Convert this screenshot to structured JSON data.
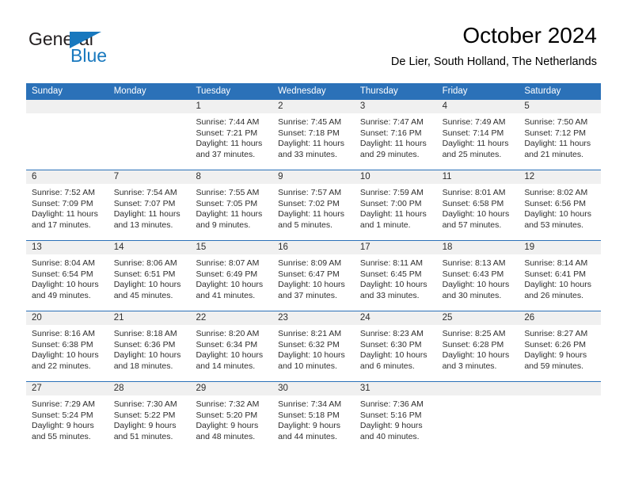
{
  "brand": {
    "name_part1": "General",
    "name_part2": "Blue",
    "mark_icon": "blue-triangle-flag-icon",
    "accent_color": "#1878be"
  },
  "header": {
    "title": "October 2024",
    "subtitle": "De Lier, South Holland, The Netherlands"
  },
  "theme": {
    "header_blue": "#2b71b8",
    "band_gray": "#f0f0f0",
    "text": "#2e2e2e"
  },
  "calendar": {
    "weekday_headers": [
      "Sunday",
      "Monday",
      "Tuesday",
      "Wednesday",
      "Thursday",
      "Friday",
      "Saturday"
    ],
    "weeks": [
      [
        {
          "day": "",
          "lines": [
            "",
            "",
            "",
            ""
          ],
          "empty": true
        },
        {
          "day": "",
          "lines": [
            "",
            "",
            "",
            ""
          ],
          "empty": true
        },
        {
          "day": "1",
          "lines": [
            "Sunrise: 7:44 AM",
            "Sunset: 7:21 PM",
            "Daylight: 11 hours",
            "and 37 minutes."
          ]
        },
        {
          "day": "2",
          "lines": [
            "Sunrise: 7:45 AM",
            "Sunset: 7:18 PM",
            "Daylight: 11 hours",
            "and 33 minutes."
          ]
        },
        {
          "day": "3",
          "lines": [
            "Sunrise: 7:47 AM",
            "Sunset: 7:16 PM",
            "Daylight: 11 hours",
            "and 29 minutes."
          ]
        },
        {
          "day": "4",
          "lines": [
            "Sunrise: 7:49 AM",
            "Sunset: 7:14 PM",
            "Daylight: 11 hours",
            "and 25 minutes."
          ]
        },
        {
          "day": "5",
          "lines": [
            "Sunrise: 7:50 AM",
            "Sunset: 7:12 PM",
            "Daylight: 11 hours",
            "and 21 minutes."
          ]
        }
      ],
      [
        {
          "day": "6",
          "lines": [
            "Sunrise: 7:52 AM",
            "Sunset: 7:09 PM",
            "Daylight: 11 hours",
            "and 17 minutes."
          ]
        },
        {
          "day": "7",
          "lines": [
            "Sunrise: 7:54 AM",
            "Sunset: 7:07 PM",
            "Daylight: 11 hours",
            "and 13 minutes."
          ]
        },
        {
          "day": "8",
          "lines": [
            "Sunrise: 7:55 AM",
            "Sunset: 7:05 PM",
            "Daylight: 11 hours",
            "and 9 minutes."
          ]
        },
        {
          "day": "9",
          "lines": [
            "Sunrise: 7:57 AM",
            "Sunset: 7:02 PM",
            "Daylight: 11 hours",
            "and 5 minutes."
          ]
        },
        {
          "day": "10",
          "lines": [
            "Sunrise: 7:59 AM",
            "Sunset: 7:00 PM",
            "Daylight: 11 hours",
            "and 1 minute."
          ]
        },
        {
          "day": "11",
          "lines": [
            "Sunrise: 8:01 AM",
            "Sunset: 6:58 PM",
            "Daylight: 10 hours",
            "and 57 minutes."
          ]
        },
        {
          "day": "12",
          "lines": [
            "Sunrise: 8:02 AM",
            "Sunset: 6:56 PM",
            "Daylight: 10 hours",
            "and 53 minutes."
          ]
        }
      ],
      [
        {
          "day": "13",
          "lines": [
            "Sunrise: 8:04 AM",
            "Sunset: 6:54 PM",
            "Daylight: 10 hours",
            "and 49 minutes."
          ]
        },
        {
          "day": "14",
          "lines": [
            "Sunrise: 8:06 AM",
            "Sunset: 6:51 PM",
            "Daylight: 10 hours",
            "and 45 minutes."
          ]
        },
        {
          "day": "15",
          "lines": [
            "Sunrise: 8:07 AM",
            "Sunset: 6:49 PM",
            "Daylight: 10 hours",
            "and 41 minutes."
          ]
        },
        {
          "day": "16",
          "lines": [
            "Sunrise: 8:09 AM",
            "Sunset: 6:47 PM",
            "Daylight: 10 hours",
            "and 37 minutes."
          ]
        },
        {
          "day": "17",
          "lines": [
            "Sunrise: 8:11 AM",
            "Sunset: 6:45 PM",
            "Daylight: 10 hours",
            "and 33 minutes."
          ]
        },
        {
          "day": "18",
          "lines": [
            "Sunrise: 8:13 AM",
            "Sunset: 6:43 PM",
            "Daylight: 10 hours",
            "and 30 minutes."
          ]
        },
        {
          "day": "19",
          "lines": [
            "Sunrise: 8:14 AM",
            "Sunset: 6:41 PM",
            "Daylight: 10 hours",
            "and 26 minutes."
          ]
        }
      ],
      [
        {
          "day": "20",
          "lines": [
            "Sunrise: 8:16 AM",
            "Sunset: 6:38 PM",
            "Daylight: 10 hours",
            "and 22 minutes."
          ]
        },
        {
          "day": "21",
          "lines": [
            "Sunrise: 8:18 AM",
            "Sunset: 6:36 PM",
            "Daylight: 10 hours",
            "and 18 minutes."
          ]
        },
        {
          "day": "22",
          "lines": [
            "Sunrise: 8:20 AM",
            "Sunset: 6:34 PM",
            "Daylight: 10 hours",
            "and 14 minutes."
          ]
        },
        {
          "day": "23",
          "lines": [
            "Sunrise: 8:21 AM",
            "Sunset: 6:32 PM",
            "Daylight: 10 hours",
            "and 10 minutes."
          ]
        },
        {
          "day": "24",
          "lines": [
            "Sunrise: 8:23 AM",
            "Sunset: 6:30 PM",
            "Daylight: 10 hours",
            "and 6 minutes."
          ]
        },
        {
          "day": "25",
          "lines": [
            "Sunrise: 8:25 AM",
            "Sunset: 6:28 PM",
            "Daylight: 10 hours",
            "and 3 minutes."
          ]
        },
        {
          "day": "26",
          "lines": [
            "Sunrise: 8:27 AM",
            "Sunset: 6:26 PM",
            "Daylight: 9 hours",
            "and 59 minutes."
          ]
        }
      ],
      [
        {
          "day": "27",
          "lines": [
            "Sunrise: 7:29 AM",
            "Sunset: 5:24 PM",
            "Daylight: 9 hours",
            "and 55 minutes."
          ]
        },
        {
          "day": "28",
          "lines": [
            "Sunrise: 7:30 AM",
            "Sunset: 5:22 PM",
            "Daylight: 9 hours",
            "and 51 minutes."
          ]
        },
        {
          "day": "29",
          "lines": [
            "Sunrise: 7:32 AM",
            "Sunset: 5:20 PM",
            "Daylight: 9 hours",
            "and 48 minutes."
          ]
        },
        {
          "day": "30",
          "lines": [
            "Sunrise: 7:34 AM",
            "Sunset: 5:18 PM",
            "Daylight: 9 hours",
            "and 44 minutes."
          ]
        },
        {
          "day": "31",
          "lines": [
            "Sunrise: 7:36 AM",
            "Sunset: 5:16 PM",
            "Daylight: 9 hours",
            "and 40 minutes."
          ]
        },
        {
          "day": "",
          "lines": [
            "",
            "",
            "",
            ""
          ],
          "empty": true
        },
        {
          "day": "",
          "lines": [
            "",
            "",
            "",
            ""
          ],
          "empty": true
        }
      ]
    ]
  }
}
